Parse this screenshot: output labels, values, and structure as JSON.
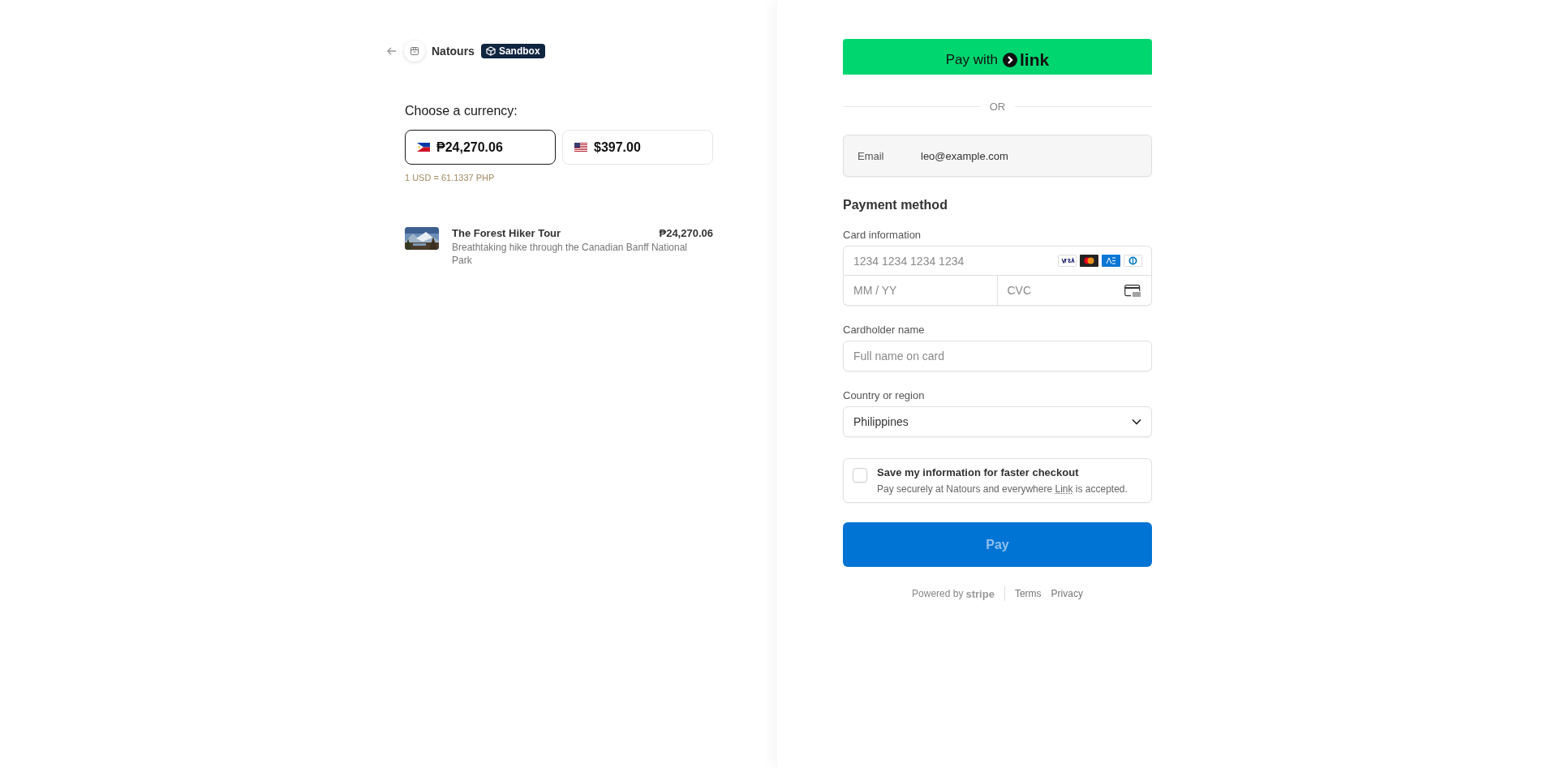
{
  "header": {
    "shop_name": "Natours",
    "badge": "Sandbox"
  },
  "currency": {
    "title": "Choose a currency:",
    "options": [
      {
        "kind": "ph",
        "amount": "₱24,270.06",
        "selected": true
      },
      {
        "kind": "us",
        "amount": "$397.00",
        "selected": false
      }
    ],
    "rate": "1 USD = 61.1337 PHP"
  },
  "items": [
    {
      "name": "The Forest Hiker Tour",
      "description": "Breathtaking hike through the Canadian Banff National Park",
      "price": "₱24,270.06"
    }
  ],
  "link_button": {
    "prefix": "Pay with",
    "brand": "link"
  },
  "divider": "OR",
  "email": {
    "label": "Email",
    "value": "leo@example.com"
  },
  "payment_method": {
    "title": "Payment method",
    "card_information": {
      "label": "Card information",
      "number_placeholder": "1234 1234 1234 1234",
      "expiry_placeholder": "MM / YY",
      "cvc_placeholder": "CVC"
    },
    "cardholder": {
      "label": "Cardholder name",
      "placeholder": "Full name on card"
    },
    "country": {
      "label": "Country or region",
      "value": "Philippines"
    }
  },
  "save_info": {
    "checked": false,
    "title": "Save my information for faster checkout",
    "description_before": "Pay securely at Natours and everywhere",
    "description_link": "Link",
    "description_after": "is accepted."
  },
  "pay_button": {
    "label": "Pay",
    "disabled": true
  },
  "footer": {
    "powered_by": "Powered by",
    "brand": "stripe",
    "links": [
      "Terms",
      "Privacy"
    ]
  }
}
